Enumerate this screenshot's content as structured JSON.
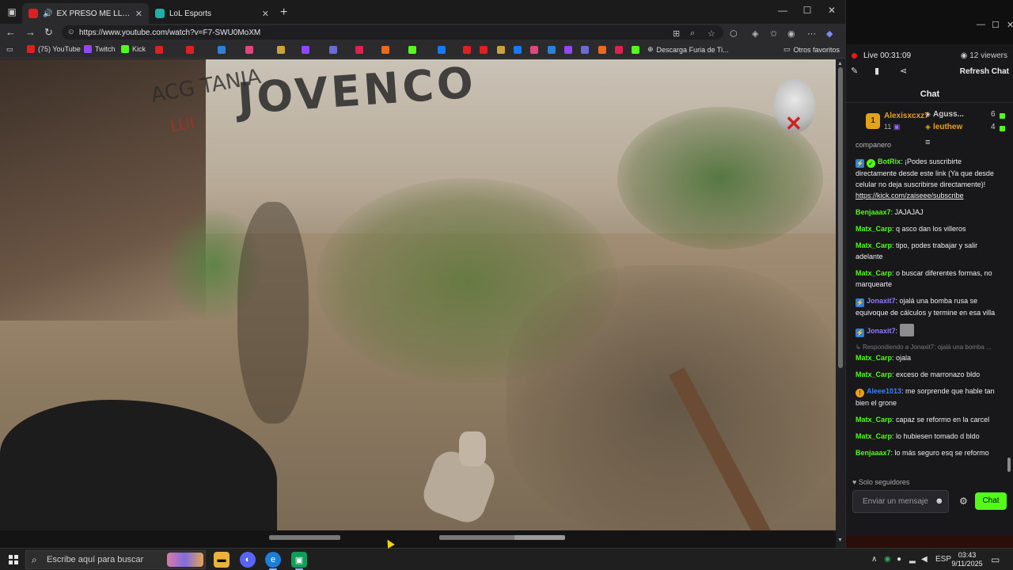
{
  "browser": {
    "tabs": [
      {
        "title": "EX PRESO ME LLEVA a LOS B",
        "favicon_color": "#e02020",
        "active": true
      },
      {
        "title": "LoL Esports",
        "favicon_color": "#1ab2a6",
        "active": false
      }
    ],
    "url": "https://www.youtube.com/watch?v=F7-SWU0MoXM",
    "bookmarks": {
      "youtube": "(75) YouTube",
      "twitch": "Twitch",
      "kick": "Kick",
      "descarga": "Descarga Furia de Ti...",
      "otros": "Otros favoritos"
    }
  },
  "video": {
    "wall_text": "JOVENCO",
    "wall_graffiti": "ACG TANIA",
    "wall_red": "LUI"
  },
  "chat_panel": {
    "live_label": "Live",
    "live_time": "00:31:09",
    "viewers": "12 viewers",
    "refresh": "Refresh Chat",
    "header": "Chat",
    "leaderboard": [
      {
        "rank": "1",
        "name": "Alexisxcxz7",
        "count": "11"
      },
      {
        "name": "Aguss...",
        "count": "6"
      },
      {
        "name": "leuthew",
        "count": "4"
      }
    ],
    "messages": [
      {
        "partial": "companero"
      },
      {
        "user": "BotRix",
        "color": "#53fc18",
        "text": ": ¡Podes suscribirte directamente desde este link (Ya que desde celular no deja suscribirse directamente)!",
        "link": "https://kick.com/zaiseee/subscribe",
        "badges": [
          "bot",
          "verified"
        ]
      },
      {
        "user": "Benjaaax7",
        "color": "#53fc18",
        "text": ": JAJAJAJ"
      },
      {
        "user": "Matx_Carp",
        "color": "#53fc18",
        "text": ": q asco dan los villeros"
      },
      {
        "user": "Matx_Carp",
        "color": "#53fc18",
        "text": ": tipo, podes trabajar y salir adelante"
      },
      {
        "user": "Matx_Carp",
        "color": "#53fc18",
        "text": ": o buscar diferentes formas, no marquearte"
      },
      {
        "user": "Jonaxit7",
        "color": "#8f7cff",
        "text": ": ojalá una bomba rusa se equivoque de cálculos y termine en esa villa",
        "badges": [
          "bot"
        ]
      },
      {
        "user": "Jonaxit7",
        "color": "#8f7cff",
        "text": ":",
        "emote": true,
        "badges": [
          "bot"
        ]
      },
      {
        "reply": "Respondiendo a Jonaxit7: ojalá una bomba ...",
        "user": "Matx_Carp",
        "color": "#53fc18",
        "text": ": ojala"
      },
      {
        "user": "Matx_Carp",
        "color": "#53fc18",
        "text": ": exceso de marronazo bldo"
      },
      {
        "user": "Aleee1013",
        "color": "#3b82f6",
        "text": ": me sorprende que hable tan bien el grone",
        "badges": [
          "gold"
        ]
      },
      {
        "user": "Matx_Carp",
        "color": "#53fc18",
        "text": ": capaz se reformo en la carcel"
      },
      {
        "user": "Matx_Carp",
        "color": "#53fc18",
        "text": ": lo hubiesen tomado d bldo"
      },
      {
        "user": "Benjaaax7",
        "color": "#53fc18",
        "text": ": lo más seguro esq se reformo"
      }
    ],
    "followers_only": "Solo seguidores",
    "input_placeholder": "Enviar un mensaje",
    "chat_button": "Chat"
  },
  "taskbar": {
    "search_placeholder": "Escribe aquí para buscar",
    "language": "ESP",
    "time": "03:43",
    "date": "9/11/2025"
  }
}
